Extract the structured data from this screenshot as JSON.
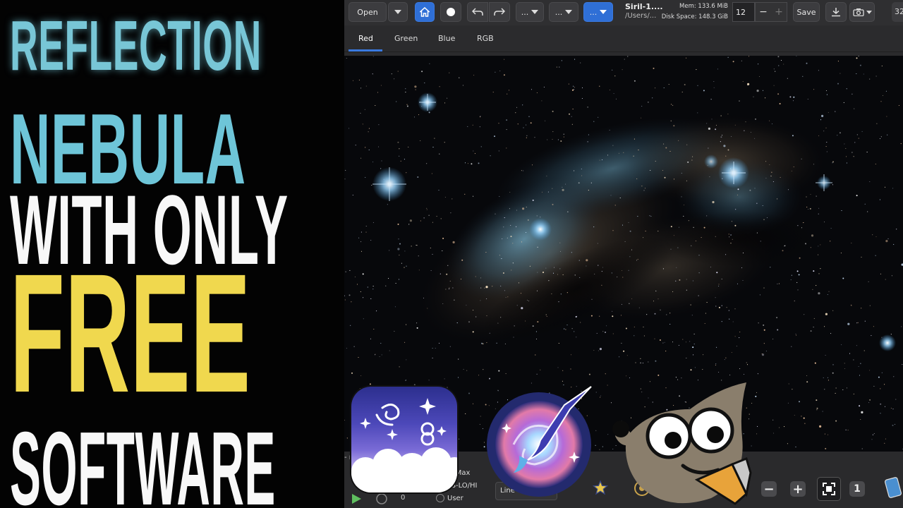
{
  "thumbnail": {
    "title_lines": [
      "REFLECTION",
      "NEBULA",
      "WITH ONLY",
      "FREE",
      "SOFTWARE"
    ]
  },
  "header": {
    "open_label": "Open",
    "dropdown_1": "...",
    "dropdown_2": "...",
    "dropdown_3": "...",
    "project_title": "Siril-1....",
    "project_path": "/Users/...",
    "memory": "Mem: 133.6 MiB",
    "disk_space": "Disk Space: 148.3 GiB",
    "thread_count": "12",
    "save_label": "Save",
    "bit_depth": "32"
  },
  "tabs": [
    {
      "label": "Red",
      "active": true
    },
    {
      "label": "Green",
      "active": false
    },
    {
      "label": "Blue",
      "active": false
    },
    {
      "label": "RGB",
      "active": false
    }
  ],
  "bottom": {
    "title_fragment": "- n",
    "radio_minmax": "n/Max",
    "radio_mips": "MIPS-LO/HI",
    "radio_user": "User",
    "scale_select": "Line",
    "slider_value": "0",
    "zoom_minus": "−",
    "zoom_plus": "+",
    "zoom_one": "1"
  },
  "icons": {
    "home": "home-icon",
    "record": "record-icon",
    "undo": "undo-icon",
    "redo": "redo-icon",
    "export": "export-icon",
    "snapshot": "camera-icon",
    "zoom_fit": "zoom-fit-icon"
  },
  "colors": {
    "title_cyan": "#6ec5d8",
    "title_white": "#f8f8f8",
    "title_yellow": "#f0d84e",
    "accent_blue": "#2f6fd6"
  }
}
